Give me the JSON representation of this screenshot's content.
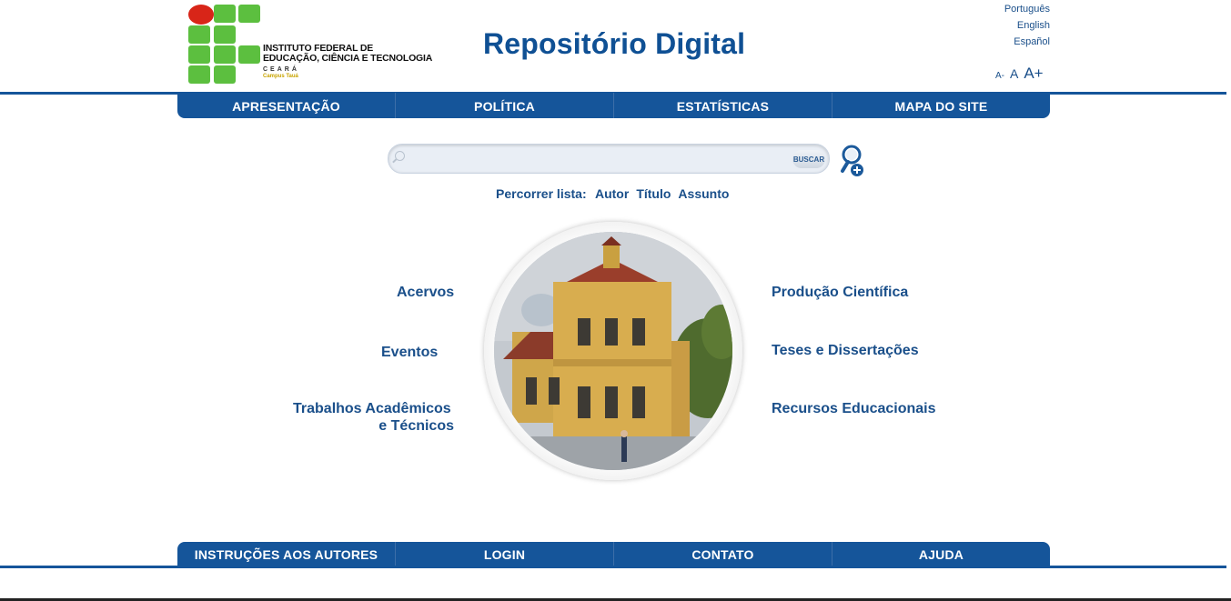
{
  "header": {
    "logo": {
      "line1": "INSTITUTO FEDERAL DE",
      "line2": "EDUCAÇÃO, CIÊNCIA E TECNOLOGIA",
      "state": "CEARÁ",
      "campus": "Campus Tauá"
    },
    "title": "Repositório Digital",
    "languages": [
      "Português",
      "English",
      "Español"
    ],
    "font_size": {
      "small": "A-",
      "normal": "A",
      "large": "A+"
    }
  },
  "top_nav": [
    "APRESENTAÇÃO",
    "POLÍTICA",
    "ESTATÍSTICAS",
    "MAPA DO SITE"
  ],
  "search": {
    "value": "",
    "placeholder": "",
    "button_label": "BUSCAR",
    "icon": "search-icon",
    "advanced_icon": "advanced-search-icon"
  },
  "browse": {
    "label": "Percorrer lista:",
    "links": [
      "Autor",
      "Título",
      "Assunto"
    ]
  },
  "categories": {
    "left": [
      "Acervos",
      "Eventos"
    ],
    "left_multiline": {
      "line1": "Trabalhos Acadêmicos",
      "line2": "e Técnicos"
    },
    "right": [
      "Produção Científica",
      "Teses e Dissertações",
      "Recursos Educacionais"
    ]
  },
  "bottom_nav": [
    "INSTRUÇÕES AOS AUTORES",
    "LOGIN",
    "CONTATO",
    "AJUDA"
  ],
  "colors": {
    "primary": "#15559a",
    "title": "#0f5094",
    "logo_green": "#5cbf3f",
    "logo_red": "#d82518"
  }
}
